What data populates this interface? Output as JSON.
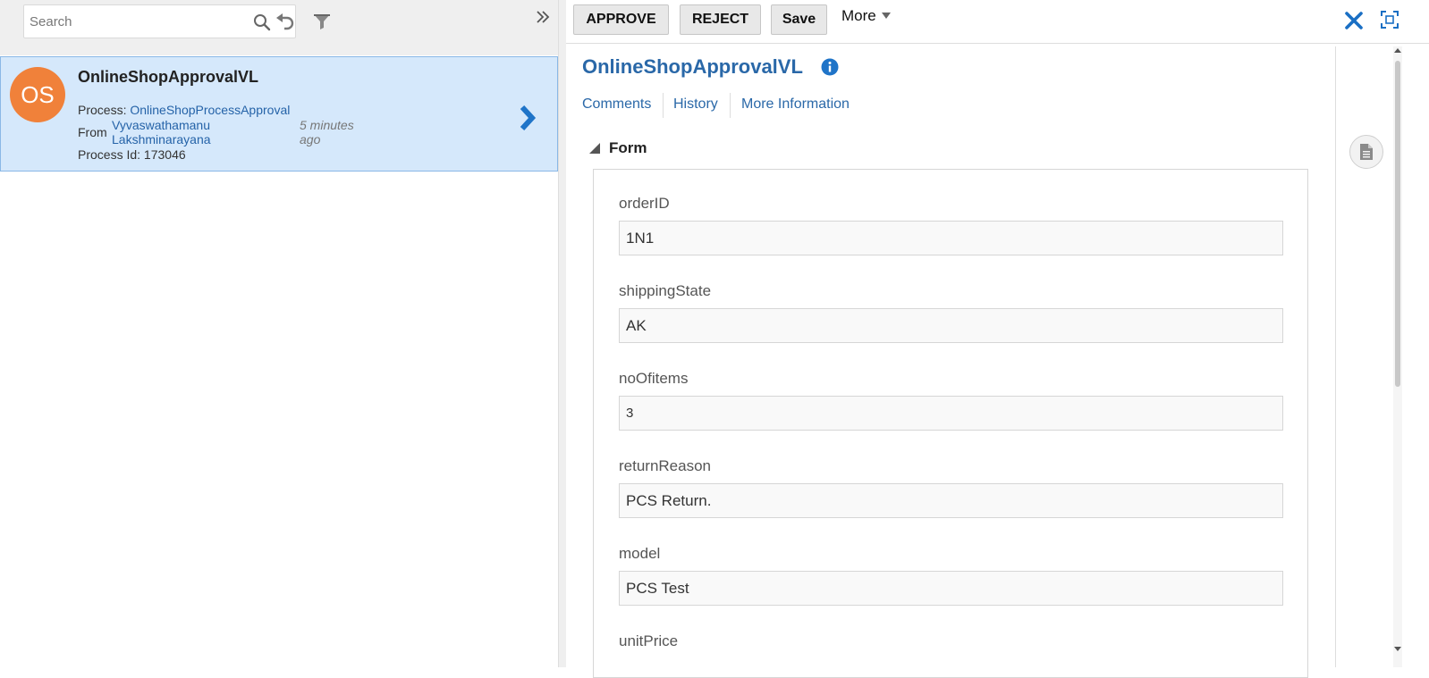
{
  "search": {
    "placeholder": "Search"
  },
  "task_card": {
    "avatar_initials": "OS",
    "title": "OnlineShopApprovalVL",
    "process_label": "Process:",
    "process_name": "OnlineShopProcessApproval",
    "from_label": "From",
    "from_name_line1": "Vyvaswathamanu",
    "from_name_line2": "Lakshminarayana",
    "time_line1": "5 minutes",
    "time_line2": "ago",
    "process_id_label": "Process Id:",
    "process_id": "173046"
  },
  "toolbar": {
    "approve_label": "APPROVE",
    "reject_label": "REJECT",
    "save_label": "Save",
    "more_label": "More"
  },
  "detail": {
    "title": "OnlineShopApprovalVL",
    "tabs": [
      {
        "label": "Comments"
      },
      {
        "label": "History"
      },
      {
        "label": "More Information"
      }
    ],
    "form_header": "Form",
    "fields": [
      {
        "label": "orderID",
        "value": "1N1"
      },
      {
        "label": "shippingState",
        "value": "AK"
      },
      {
        "label": "noOfitems",
        "value": "3"
      },
      {
        "label": "returnReason",
        "value": "PCS Return."
      },
      {
        "label": "model",
        "value": "PCS Test"
      },
      {
        "label": "unitPrice",
        "value": ""
      }
    ]
  },
  "colors": {
    "accent": "#2a68a8",
    "avatar": "#f0813a",
    "selected_card": "#d5e8fb"
  },
  "icons": [
    "search-icon",
    "undo-icon",
    "filter-icon",
    "collapse-icon",
    "chevron-right-icon",
    "close-icon",
    "maximize-icon",
    "info-icon",
    "triangle-down-icon",
    "document-icon"
  ]
}
